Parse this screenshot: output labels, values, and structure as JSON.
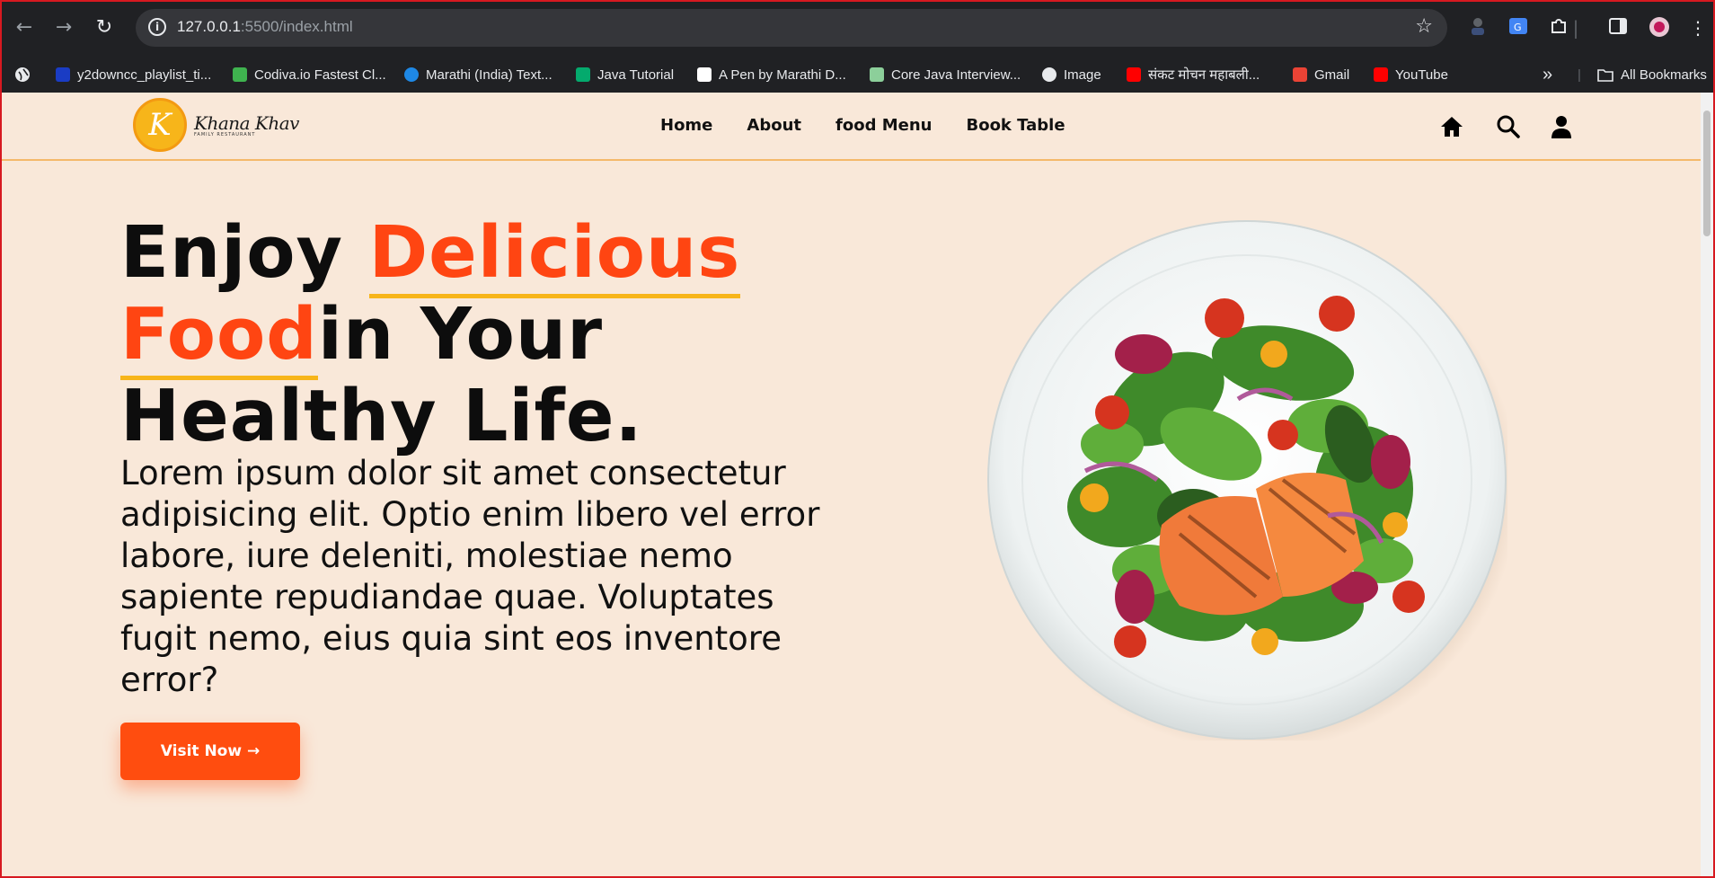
{
  "browser": {
    "url_host": "127.0.0.1",
    "url_rest": ":5500/index.html",
    "bookmarks": [
      {
        "label": "y2downcc_playlist_ti...",
        "color": "#1a3cc4"
      },
      {
        "label": "Codiva.io Fastest Cl...",
        "color": "#3fb34f"
      },
      {
        "label": "Marathi (India) Text...",
        "color": "#1e88e5"
      },
      {
        "label": "Java Tutorial",
        "color": "#04aa6d"
      },
      {
        "label": "A Pen by Marathi D...",
        "color": "#ffffff"
      },
      {
        "label": "Core Java Interview...",
        "color": "#8ccf9a"
      },
      {
        "label": "Image",
        "color": "#e8eaed"
      },
      {
        "label": "संकट मोचन महाबली...",
        "color": "#ff0000"
      },
      {
        "label": "Gmail",
        "color": "#ea4335"
      },
      {
        "label": "YouTube",
        "color": "#ff0000"
      }
    ],
    "all_bookmarks": "All Bookmarks",
    "overflow": "»"
  },
  "site": {
    "logo_letter": "K",
    "logo_name": "Khana Khav",
    "logo_sub": "FAMILY RESTAURANT",
    "nav": [
      "Home",
      "About",
      "food Menu",
      "Book Table"
    ]
  },
  "hero": {
    "title_part1": "Enjoy ",
    "title_highlight1": "Delicious",
    "title_highlight2": "Food",
    "title_part2": "in Your",
    "title_part3": "Healthy Life.",
    "description": "Lorem ipsum dolor sit amet consectetur adipisicing elit. Optio enim libero vel error labore, iure deleniti, molestiae nemo sapiente repudiandae quae. Voluptates fugit nemo, eius quia sint eos inventore error?",
    "cta_label": "Visit Now →"
  },
  "colors": {
    "accent": "#ff4512",
    "underline": "#f7b51a",
    "background": "#f9e8d9"
  }
}
